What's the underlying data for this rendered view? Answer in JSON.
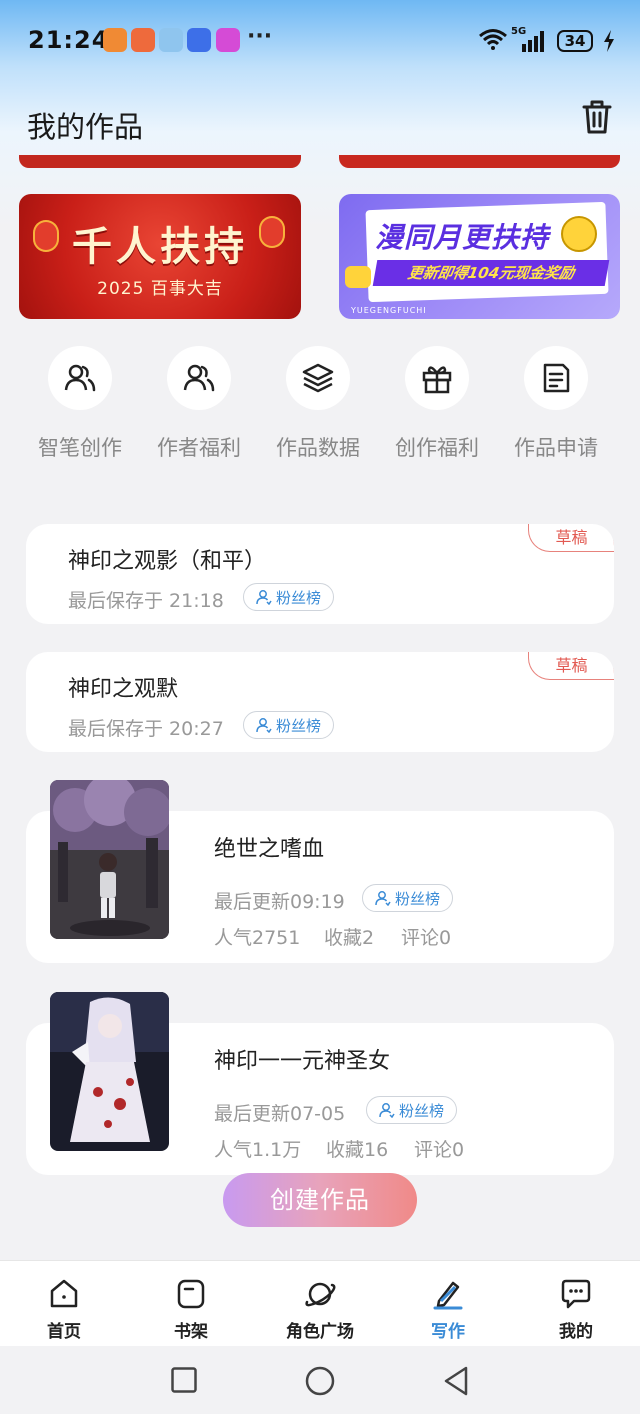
{
  "status": {
    "time": "21:24",
    "network": "5G",
    "battery": "34",
    "more": "···"
  },
  "header": {
    "title": "我的作品"
  },
  "banners": [
    {
      "title": "千人扶持",
      "subtitle": "2025 百事大吉"
    },
    {
      "title": "漫同月更扶持",
      "subtitle": "更新即得104元现金奖励",
      "small": "YUEGENGFUCHI"
    }
  ],
  "quick_actions": [
    {
      "label": "智笔创作",
      "icon": "people-icon"
    },
    {
      "label": "作者福利",
      "icon": "people-icon"
    },
    {
      "label": "作品数据",
      "icon": "layers-icon"
    },
    {
      "label": "创作福利",
      "icon": "gift-icon"
    },
    {
      "label": "作品申请",
      "icon": "document-icon"
    }
  ],
  "drafts": [
    {
      "title": "神印之观影（和平）",
      "saved": "最后保存于 21:18",
      "badge": "草稿",
      "fan": "粉丝榜"
    },
    {
      "title": "神印之观默",
      "saved": "最后保存于 20:27",
      "badge": "草稿",
      "fan": "粉丝榜"
    }
  ],
  "works": [
    {
      "title": "绝世之嗜血",
      "updated": "最后更新09:19",
      "fan": "粉丝榜",
      "popularity": "人气2751",
      "favorites": "收藏2",
      "comments": "评论0"
    },
    {
      "title": "神印一一元神圣女",
      "updated": "最后更新07-05",
      "fan": "粉丝榜",
      "popularity": "人气1.1万",
      "favorites": "收藏16",
      "comments": "评论0"
    }
  ],
  "create_button": "创建作品",
  "nav": [
    {
      "label": "首页",
      "icon": "home-icon"
    },
    {
      "label": "书架",
      "icon": "bookshelf-icon"
    },
    {
      "label": "角色广场",
      "icon": "planet-icon"
    },
    {
      "label": "写作",
      "icon": "pen-icon",
      "active": true
    },
    {
      "label": "我的",
      "icon": "chat-icon"
    }
  ],
  "colors": {
    "accent": "#3a8bd6",
    "draft": "#e25a52",
    "banner_red": "#c91f18",
    "banner_purple": "#8b78f4"
  }
}
